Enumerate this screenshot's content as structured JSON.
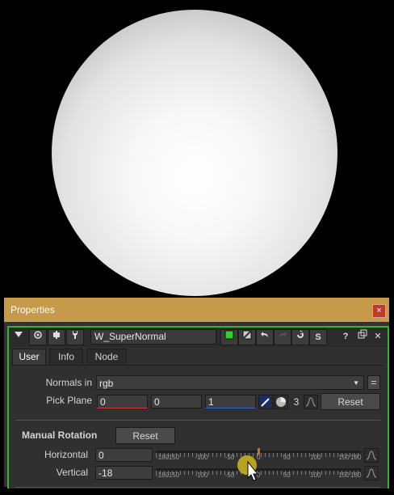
{
  "panel": {
    "title": "Properties",
    "close_glyph": "×"
  },
  "node": {
    "name": "W_SuperNormal",
    "toolbar_icons": [
      "collapse-arrow-icon",
      "center-viewer-icon",
      "node-settings-icon",
      "wrench-icon",
      "node-color-icon",
      "node-icon-color-icon",
      "undo-icon",
      "redo-icon",
      "revert-icon",
      "script-icon",
      "help-icon",
      "float-panel-icon",
      "close-node-icon"
    ],
    "toolbar_labels": {
      "s_label": "S",
      "help_label": "?",
      "close_label": "✕"
    }
  },
  "tabs": [
    {
      "label": "User",
      "active": true
    },
    {
      "label": "Info",
      "active": false
    },
    {
      "label": "Node",
      "active": false
    }
  ],
  "normals_in": {
    "label": "Normals in",
    "value": "rgb",
    "eq_label": "="
  },
  "pick_plane": {
    "label": "Pick Plane",
    "values": [
      "0",
      "0",
      "1"
    ],
    "count": "3",
    "reset_label": "Reset"
  },
  "manual_rotation": {
    "label": "Manual Rotation",
    "reset_label": "Reset"
  },
  "horizontal": {
    "label": "Horizontal",
    "value": "0",
    "slider_value": 0
  },
  "vertical": {
    "label": "Vertical",
    "value": "-18",
    "slider_value": -18
  },
  "slider_ticks": [
    "-180",
    "-150",
    "-100",
    "-50",
    "0",
    "50",
    "100",
    "150",
    "180"
  ],
  "colors": {
    "accent_green": "#2fb52f",
    "title_bar": "#c69a48",
    "cursor_highlight": "#c8b020"
  }
}
